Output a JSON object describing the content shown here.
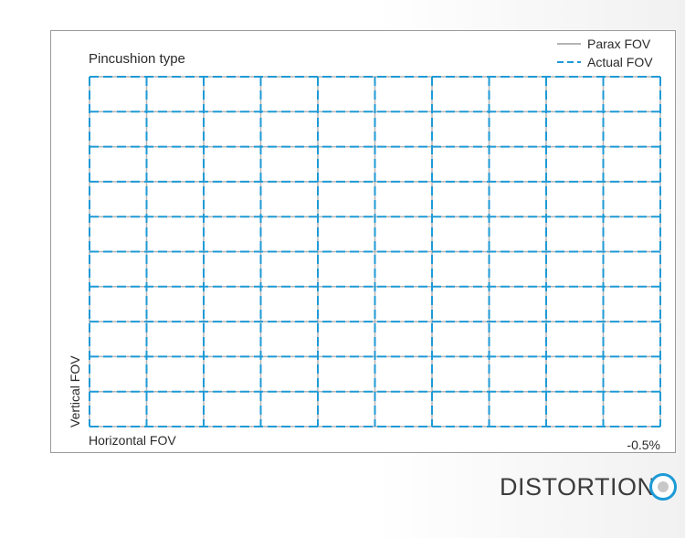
{
  "chart_data": {
    "type": "line",
    "title": "Pincushion type",
    "xlabel": "Horizontal FOV",
    "ylabel": "Vertical FOV",
    "distortion_label": "-0.5%",
    "grid_columns": 10,
    "grid_rows": 10,
    "xlim": [
      0,
      10
    ],
    "ylim": [
      0,
      10
    ],
    "distortion_percent": -0.5,
    "series": [
      {
        "name": "Parax FOV",
        "style": "solid",
        "color": "#b4b4b4"
      },
      {
        "name": "Actual FOV",
        "style": "dashed",
        "color": "#1e9ad6"
      }
    ],
    "legend_position": "top-right"
  },
  "footer": {
    "label": "DISTORTION",
    "icon": "target-circle-icon",
    "accent_color": "#1e9ad6"
  }
}
